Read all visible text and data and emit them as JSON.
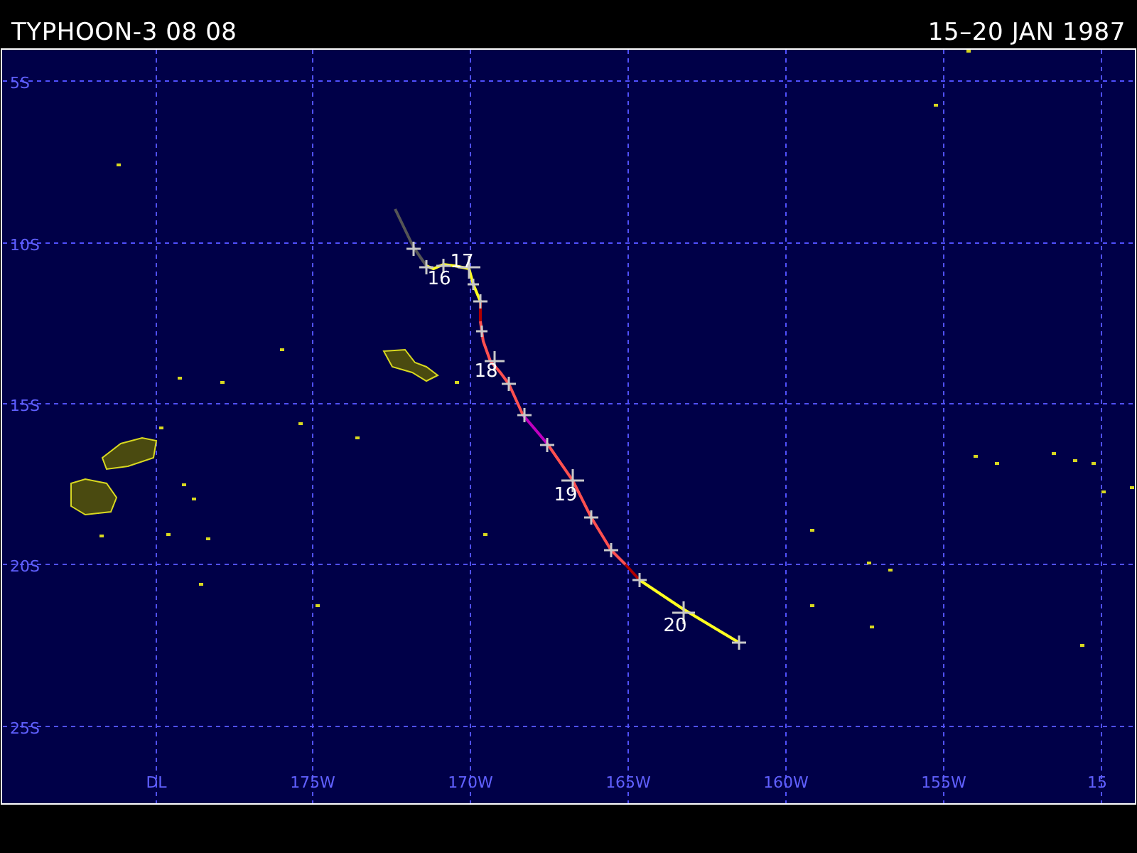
{
  "header": {
    "title": "TYPHOON-3 08 08",
    "dates": "15–20 JAN 1987"
  },
  "map": {
    "lat_labels": [
      "5S",
      "10S",
      "15S",
      "20S",
      "25S"
    ],
    "lon_labels": [
      "DL",
      "175W",
      "170W",
      "165W",
      "160W",
      "155W",
      "15"
    ],
    "day_labels": [
      "16",
      "17",
      "18",
      "19",
      "20"
    ]
  }
}
